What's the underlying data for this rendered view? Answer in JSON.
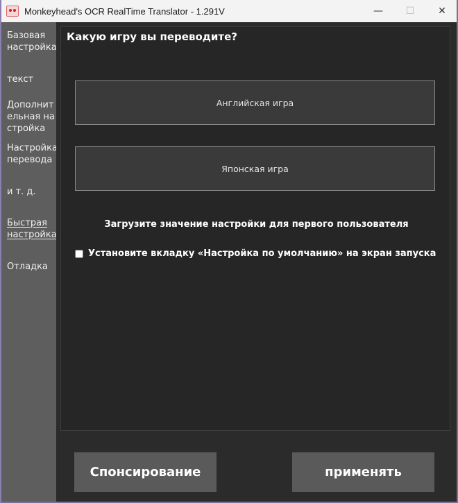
{
  "window": {
    "title": "Monkeyhead's OCR RealTime Translator - 1.291V",
    "minimize_glyph": "—",
    "maximize_glyph": "☐",
    "close_glyph": "✕"
  },
  "sidebar": {
    "items": [
      {
        "label": "Базовая настройка",
        "active": false
      },
      {
        "label": "текст",
        "active": false
      },
      {
        "label": "Дополнительная настройка",
        "active": false
      },
      {
        "label": "Настройка перевода",
        "active": false
      },
      {
        "label": "и т. д.",
        "active": false
      },
      {
        "label": "Быстрая настройка",
        "active": true
      },
      {
        "label": "Отладка",
        "active": false
      }
    ]
  },
  "main": {
    "question": "Какую игру вы переводите?",
    "english_game_label": "Английская игра",
    "japanese_game_label": "Японская игра",
    "load_settings_text": "Загрузите значение настройки для первого пользователя",
    "startup_checkbox_label": "Установите вкладку «Настройка по умолчанию» на экран запуска",
    "startup_checkbox_checked": false
  },
  "footer": {
    "sponsor_label": "Спонсирование",
    "apply_label": "применять"
  }
}
